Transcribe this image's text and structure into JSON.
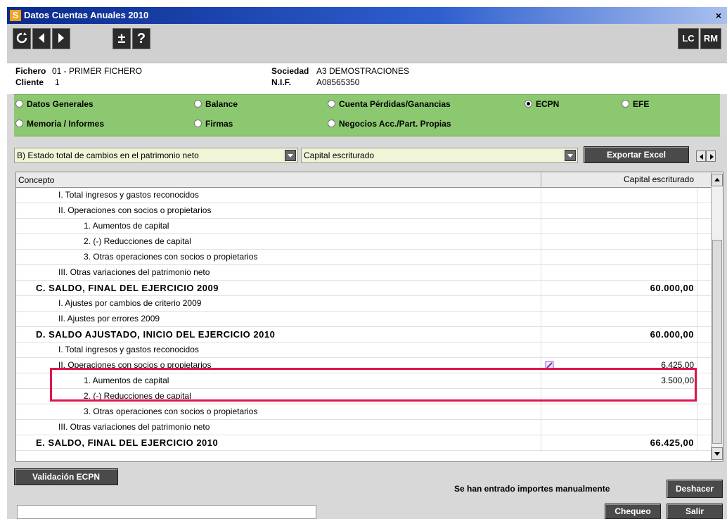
{
  "window": {
    "title": "Datos Cuentas Anuales 2010",
    "app_icon_letter": "S",
    "close_glyph": "×"
  },
  "toolbar": {
    "icons": [
      "refresh-icon",
      "back-icon",
      "forward-icon",
      "plus-minus-icon",
      "help-icon"
    ],
    "plus_minus": "±",
    "help": "?",
    "lc": "LC",
    "rm": "RM"
  },
  "info": {
    "fichero_label": "Fichero",
    "fichero_value": "01 - PRIMER FICHERO",
    "cliente_label": "Cliente",
    "cliente_value": "1",
    "sociedad_label": "Sociedad",
    "sociedad_value": "A3 DEMOSTRACIONES",
    "nif_label": "N.I.F.",
    "nif_value": "A08565350"
  },
  "sections": [
    {
      "label": "Datos Generales",
      "selected": false
    },
    {
      "label": "Balance",
      "selected": false
    },
    {
      "label": "Cuenta Pérdidas/Ganancias",
      "selected": false
    },
    {
      "label": "ECPN",
      "selected": true
    },
    {
      "label": "EFE",
      "selected": false
    },
    {
      "label": "Memoria / Informes",
      "selected": false
    },
    {
      "label": "Firmas",
      "selected": false
    },
    {
      "label": "Negocios Acc./Part. Propias",
      "selected": false
    }
  ],
  "filters": {
    "estado": "B) Estado total de cambios en el patrimonio neto",
    "columna": "Capital escriturado",
    "export_label": "Exportar Excel"
  },
  "grid": {
    "col_concepto": "Concepto",
    "col_capital": "Capital escriturado",
    "rows": [
      {
        "text": "I. Total ingresos y gastos reconocidos",
        "value": "",
        "level": 2,
        "bold": false
      },
      {
        "text": "II. Operaciones con socios o propietarios",
        "value": "",
        "level": 2,
        "bold": false
      },
      {
        "text": "1. Aumentos de capital",
        "value": "",
        "level": 3,
        "bold": false
      },
      {
        "text": "2. (-) Reducciones de capital",
        "value": "",
        "level": 3,
        "bold": false
      },
      {
        "text": "3. Otras operaciones con socios o propietarios",
        "value": "",
        "level": 3,
        "bold": false
      },
      {
        "text": "III. Otras variaciones del patrimonio neto",
        "value": "",
        "level": 2,
        "bold": false
      },
      {
        "text": "C. SALDO, FINAL DEL EJERCICIO 2009",
        "value": "60.000,00",
        "level": 1,
        "bold": true
      },
      {
        "text": "I. Ajustes por cambios de criterio 2009",
        "value": "",
        "level": 2,
        "bold": false
      },
      {
        "text": "II. Ajustes por errores 2009",
        "value": "",
        "level": 2,
        "bold": false
      },
      {
        "text": "D. SALDO AJUSTADO, INICIO DEL EJERCICIO 2010",
        "value": "60.000,00",
        "level": 1,
        "bold": true
      },
      {
        "text": "I. Total ingresos y gastos reconocidos",
        "value": "",
        "level": 2,
        "bold": false
      },
      {
        "text": "II. Operaciones con socios o propietarios",
        "value": "6.425,00",
        "level": 2,
        "bold": false,
        "edit_icon": "pencil-icon"
      },
      {
        "text": "1. Aumentos de capital",
        "value": "3.500,00",
        "level": 3,
        "bold": false
      },
      {
        "text": "2. (-) Reducciones de capital",
        "value": "",
        "level": 3,
        "bold": false
      },
      {
        "text": "3. Otras operaciones con socios o propietarios",
        "value": "",
        "level": 3,
        "bold": false
      },
      {
        "text": "III. Otras variaciones del patrimonio neto",
        "value": "",
        "level": 2,
        "bold": false
      },
      {
        "text": "E. SALDO, FINAL DEL EJERCICIO 2010",
        "value": "66.425,00",
        "level": 1,
        "bold": true
      }
    ],
    "highlight_color": "#e0144c"
  },
  "footer": {
    "validacion": "Validación ECPN",
    "message": "Se han entrado importes manualmente",
    "deshacer": "Deshacer",
    "chequeo": "Chequeo",
    "salir": "Salir"
  }
}
